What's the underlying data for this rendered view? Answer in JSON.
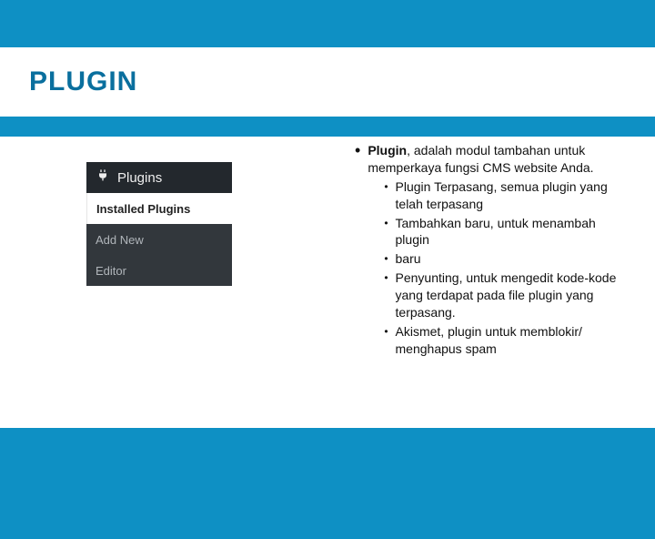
{
  "title": "PLUGIN",
  "wp": {
    "header": "Plugins",
    "installed": "Installed Plugins",
    "addnew": "Add New",
    "editor": "Editor"
  },
  "main": {
    "bold": "Plugin",
    "lead": ", adalah modul tambahan untuk memperkaya fungsi CMS website Anda.",
    "items": [
      "Plugin Terpasang, semua plugin yang telah terpasang",
      "Tambahkan baru, untuk menambah plugin",
      "baru",
      "Penyunting, untuk mengedit kode-kode yang terdapat pada file plugin yang terpasang.",
      "Akismet, plugin untuk memblokir/ menghapus spam"
    ]
  }
}
